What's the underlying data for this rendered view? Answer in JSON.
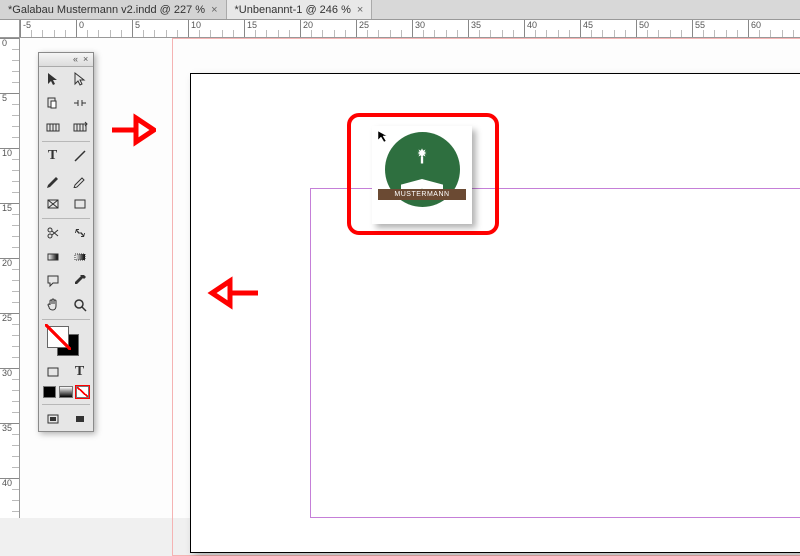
{
  "tabs": [
    {
      "label": "*Galabau Mustermann v2.indd @ 227 %",
      "active": false
    },
    {
      "label": "*Unbenannt-1 @ 246 %",
      "active": true
    }
  ],
  "top_ruler_ticks": [
    "-5",
    "0",
    "5",
    "10",
    "15",
    "20",
    "25",
    "30",
    "35",
    "40",
    "45",
    "50",
    "55",
    "60"
  ],
  "left_ruler_ticks": [
    "0",
    "5",
    "10",
    "15",
    "20",
    "25",
    "30",
    "35",
    "40"
  ],
  "logo": {
    "name": "MUSTERMANN"
  },
  "tools": {
    "selection": "Selection",
    "direct": "Direct Selection",
    "page": "Page",
    "gap": "Gap",
    "content_collector": "Content Collector",
    "content_placer": "Content Placer",
    "type": "Type",
    "line": "Line",
    "pen": "Pen",
    "pencil": "Pencil",
    "rect_frame": "Rectangle Frame",
    "rect": "Rectangle",
    "scissors": "Scissors",
    "free_transform": "Free Transform",
    "gradient_swatch": "Gradient Swatch",
    "gradient_feather": "Gradient Feather",
    "note": "Note",
    "eyedropper": "Eyedropper",
    "hand": "Hand",
    "zoom": "Zoom",
    "fill_stroke": "Fill / Stroke",
    "format_container": "Formatting affects container",
    "format_text": "Formatting affects text",
    "apply_color": "Apply Color",
    "apply_gradient": "Apply Gradient",
    "apply_none": "Apply None",
    "view_normal": "Normal",
    "view_preview": "Preview"
  }
}
